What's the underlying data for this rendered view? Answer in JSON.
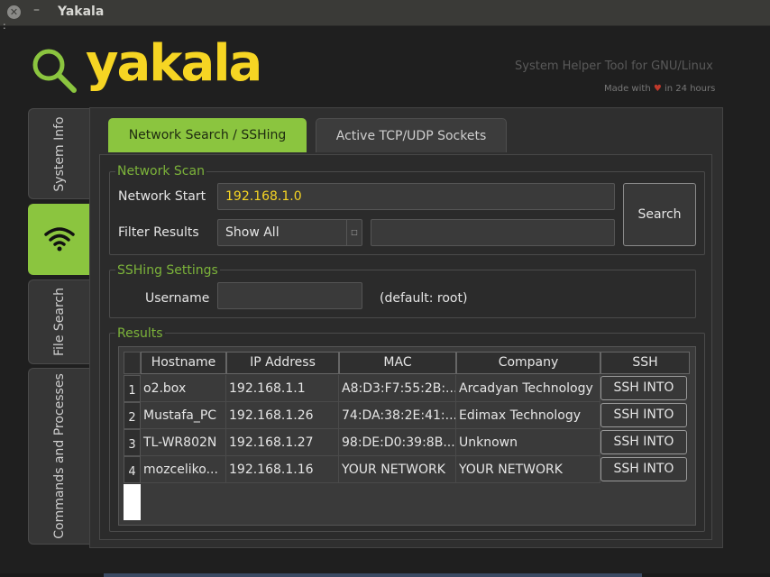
{
  "window": {
    "title": "Yakala",
    "close_glyph": "✕",
    "minimize_glyph": "–",
    "stray_text": ":"
  },
  "header": {
    "logo_text": "yakala",
    "tagline": "System Helper Tool for GNU/Linux",
    "made_with_prefix": "Made with",
    "made_with_suffix": "in 24 hours",
    "heart_glyph": "♥",
    "logo_icon": "magnifier-icon",
    "colors": {
      "accent_green": "#8bc53f",
      "logo_yellow": "#f6d523"
    }
  },
  "side_tabs": [
    {
      "label": "System Info",
      "active": false
    },
    {
      "label": "",
      "icon": "wifi-icon",
      "active": true
    },
    {
      "label": "File Search",
      "active": false
    },
    {
      "label": "Commands and Processes",
      "active": false
    }
  ],
  "top_tabs": [
    {
      "label": "Network Search / SSHing",
      "active": true
    },
    {
      "label": "Active TCP/UDP Sockets",
      "active": false
    }
  ],
  "network_scan": {
    "title": "Network Scan",
    "network_start_label": "Network Start",
    "network_start_value": "192.168.1.0",
    "filter_label": "Filter Results",
    "filter_selected": "Show All",
    "filter_text_value": "",
    "search_button": "Search"
  },
  "ssh_settings": {
    "title": "SSHing Settings",
    "username_label": "Username",
    "username_value": "",
    "default_hint": "(default: root)"
  },
  "results": {
    "title": "Results",
    "columns": [
      "Hostname",
      "IP Address",
      "MAC",
      "Company",
      "SSH"
    ],
    "rows": [
      {
        "num": "1",
        "hostname": "o2.box",
        "ip": "192.168.1.1",
        "mac": "A8:D3:F7:55:2B:...",
        "company": "Arcadyan Technology",
        "ssh": "SSH INTO"
      },
      {
        "num": "2",
        "hostname": "Mustafa_PC",
        "ip": "192.168.1.26",
        "mac": "74:DA:38:2E:41:...",
        "company": "Edimax Technology",
        "ssh": "SSH INTO"
      },
      {
        "num": "3",
        "hostname": "TL-WR802N",
        "ip": "192.168.1.27",
        "mac": "98:DE:D0:39:8B...",
        "company": "Unknown",
        "ssh": "SSH INTO"
      },
      {
        "num": "4",
        "hostname": "mozceliko...",
        "ip": "192.168.1.16",
        "mac": "YOUR NETWORK",
        "company": "YOUR NETWORK",
        "ssh": "SSH INTO"
      }
    ]
  }
}
